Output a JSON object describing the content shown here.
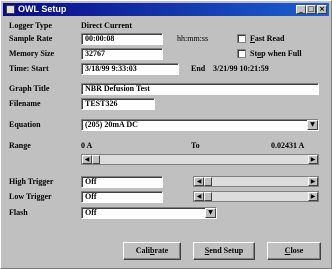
{
  "window": {
    "title": "OWL Setup",
    "controls": [
      "_",
      "□",
      "×"
    ]
  },
  "logger_type": {
    "label": "Logger Type",
    "value": "Direct Current"
  },
  "sample_rate": {
    "label": "Sample Rate",
    "value": "00:00:08",
    "unit": "hh:mm:ss"
  },
  "fast_read": {
    "label_pre": "",
    "label_u": "F",
    "label_post": "ast Read",
    "checked": false
  },
  "memory_size": {
    "label": "Memory Size",
    "value": "32767"
  },
  "stop_when_full": {
    "label_pre": "St",
    "label_u": "o",
    "label_post": "p when Full",
    "checked": false
  },
  "time_start": {
    "label": "Time: Start",
    "value": "3/18/99 9:33:03",
    "end_label": "End",
    "end_value": "3/21/99 10:21:59"
  },
  "graph_title": {
    "label": "Graph Title",
    "value": "NBR Defusion Test"
  },
  "filename": {
    "label": "Filename",
    "value": "TEST326"
  },
  "equation": {
    "label": "Equation",
    "value": "(205) 20mA DC"
  },
  "range": {
    "label": "Range",
    "from": "0 A",
    "to_label": "To",
    "to": "0.02431 A"
  },
  "high_trigger": {
    "label": "High Trigger",
    "value": "Off"
  },
  "low_trigger": {
    "label": "Low Trigger",
    "value": "Off"
  },
  "flash": {
    "label": "Flash",
    "value": "Off"
  },
  "buttons": {
    "calibrate": {
      "pre": "Cali",
      "u": "b",
      "post": "rate"
    },
    "send_setup": {
      "pre": "",
      "u": "S",
      "post": "end Setup"
    },
    "close": {
      "pre": "",
      "u": "C",
      "post": "lose"
    }
  }
}
